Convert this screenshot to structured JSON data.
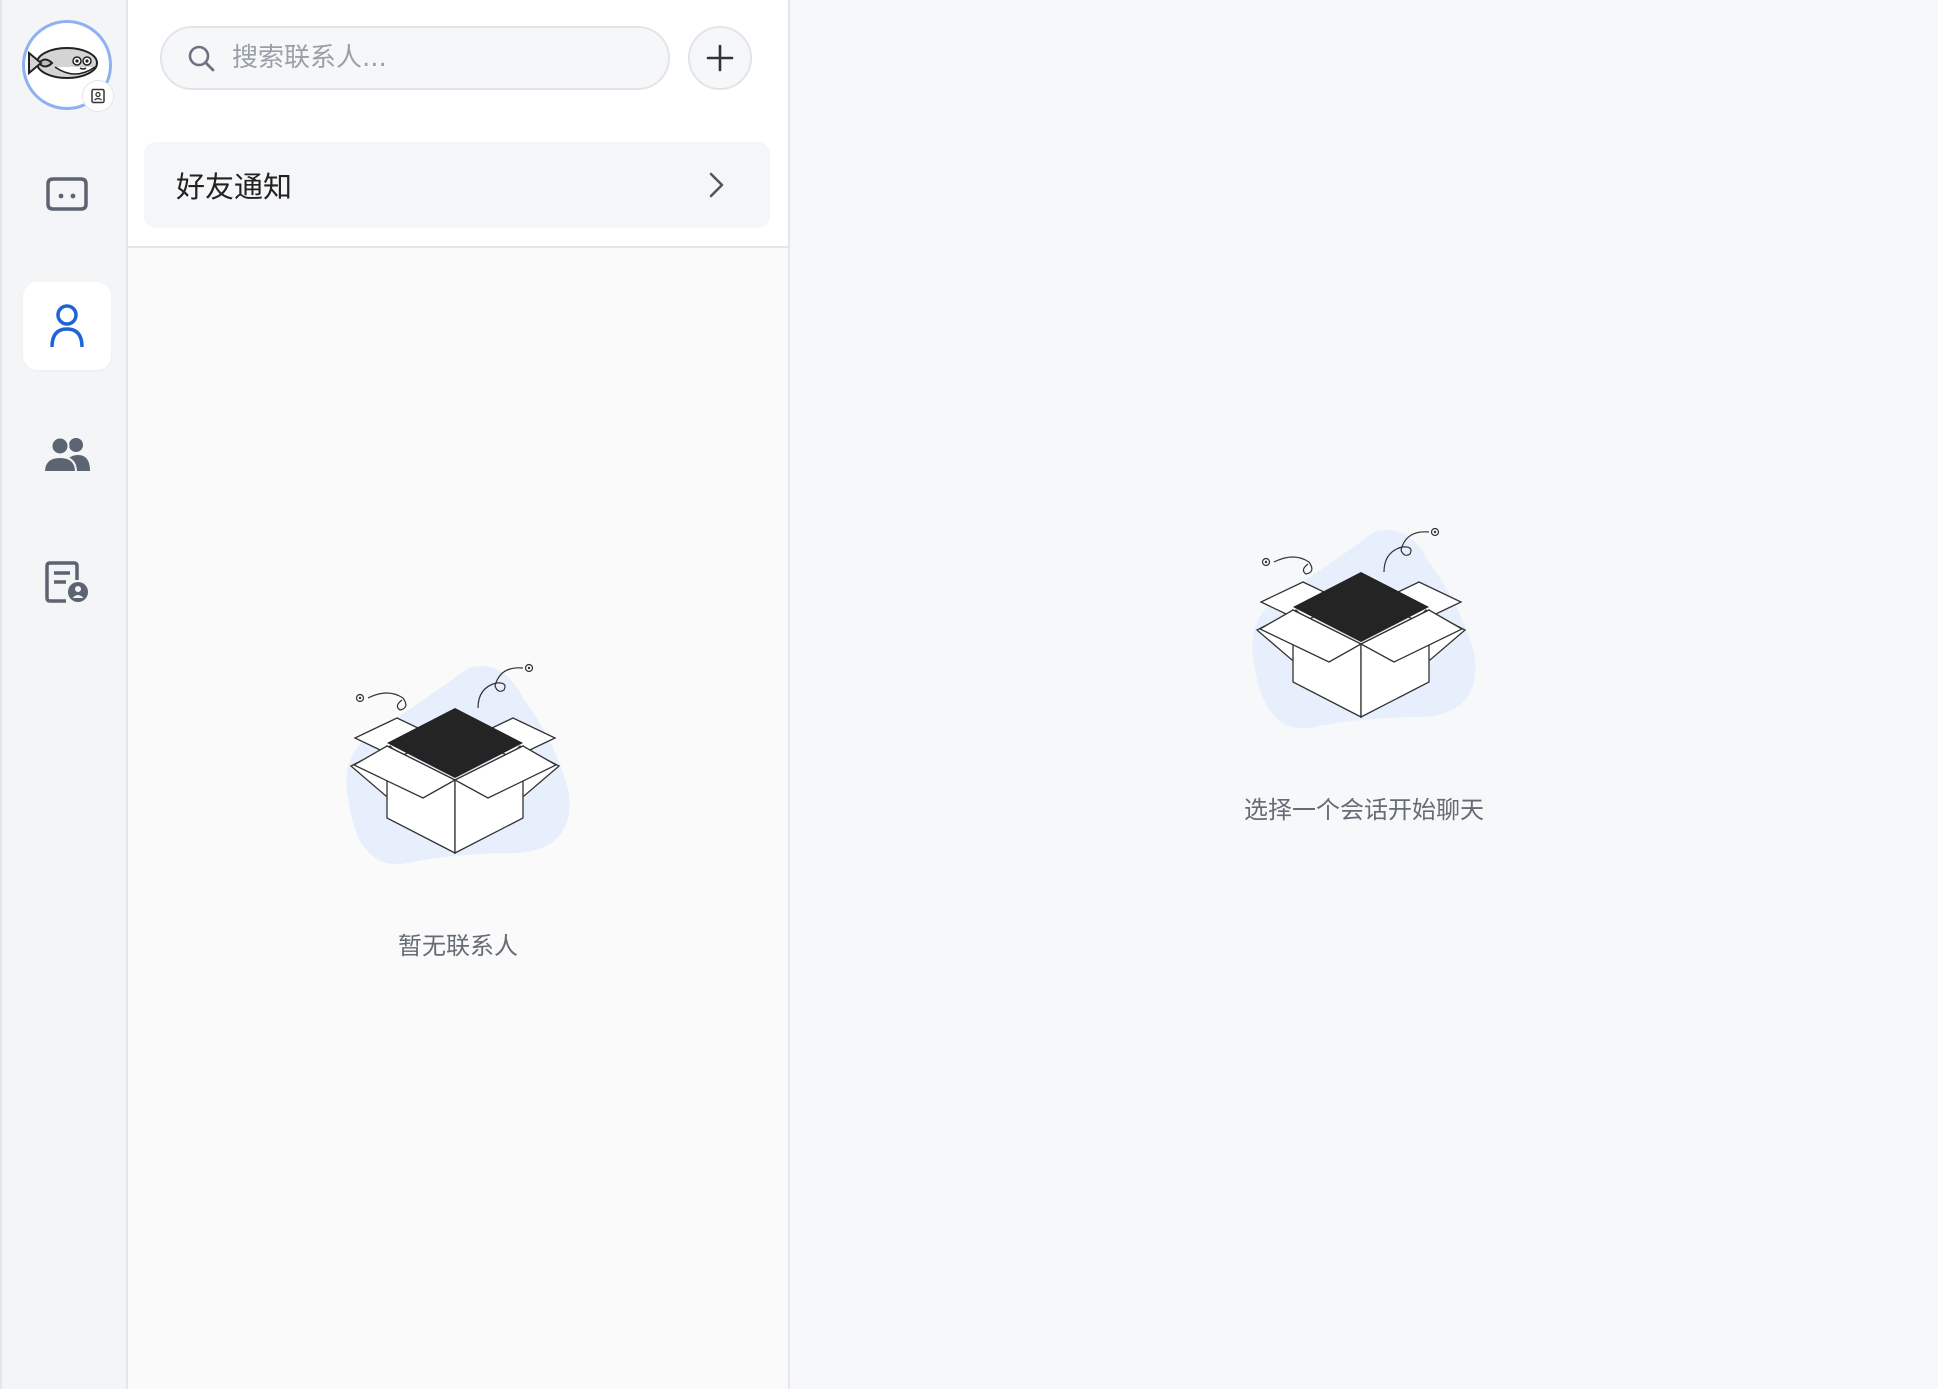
{
  "rail": {
    "avatar": "avatar-image",
    "avatar_badge": "contact-card-icon",
    "items": [
      {
        "id": "chat",
        "icon": "chat-bubble-icon",
        "active": false
      },
      {
        "id": "contacts",
        "icon": "person-icon",
        "active": true
      },
      {
        "id": "groups",
        "icon": "users-icon",
        "active": false
      },
      {
        "id": "requests",
        "icon": "contact-request-icon",
        "active": false
      }
    ]
  },
  "contacts": {
    "search": {
      "placeholder": "搜索联系人..."
    },
    "add_icon": "plus-icon",
    "friend_notify_label": "好友通知",
    "empty_text": "暂无联系人"
  },
  "chat": {
    "empty_text": "选择一个会话开始聊天"
  },
  "colors": {
    "accent": "#1f63d9",
    "blob": "#e7effc",
    "icon_gray": "#5b6470"
  }
}
